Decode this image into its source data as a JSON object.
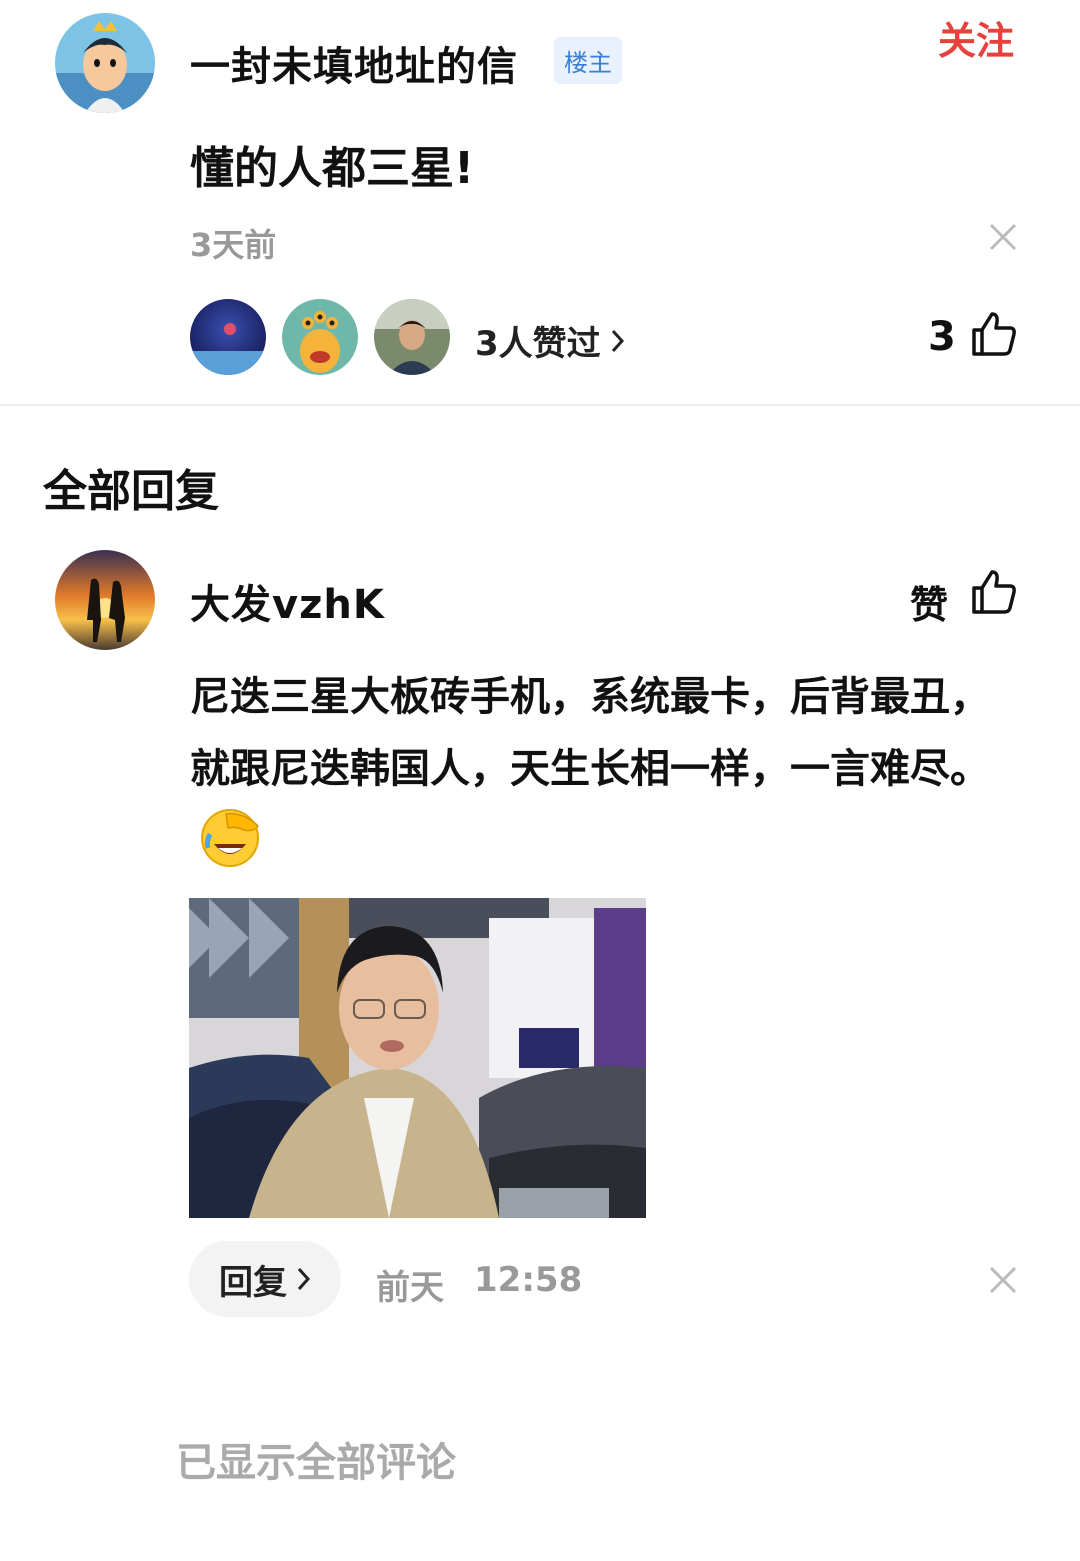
{
  "post": {
    "author": "一封未填地址的信",
    "author_badge": "楼主",
    "follow_label": "关注",
    "content": "懂的人都三星!",
    "time": "3天前",
    "likers_text": "3人赞过",
    "like_count": "3"
  },
  "replies_section": {
    "title": "全部回复"
  },
  "reply": {
    "author": "大发vzhK",
    "like_label": "赞",
    "content": "尼迭三星大板砖手机，系统最卡，后背最丑，就跟尼迭韩国人，天生长相一样，一言难尽。",
    "reply_button": "回复",
    "time_day": "前天",
    "time_clock": "12:58"
  },
  "footer": {
    "all_shown": "已显示全部评论"
  },
  "icons": {
    "thumb": "thumbs-up-icon",
    "close": "close-icon",
    "chevron": "chevron-right-icon",
    "emoji": "facepalm-laugh-emoji"
  },
  "colors": {
    "follow": "#e8413b",
    "badge_text": "#3a7fd5",
    "badge_bg": "#e8f1fd",
    "meta": "#999999"
  }
}
